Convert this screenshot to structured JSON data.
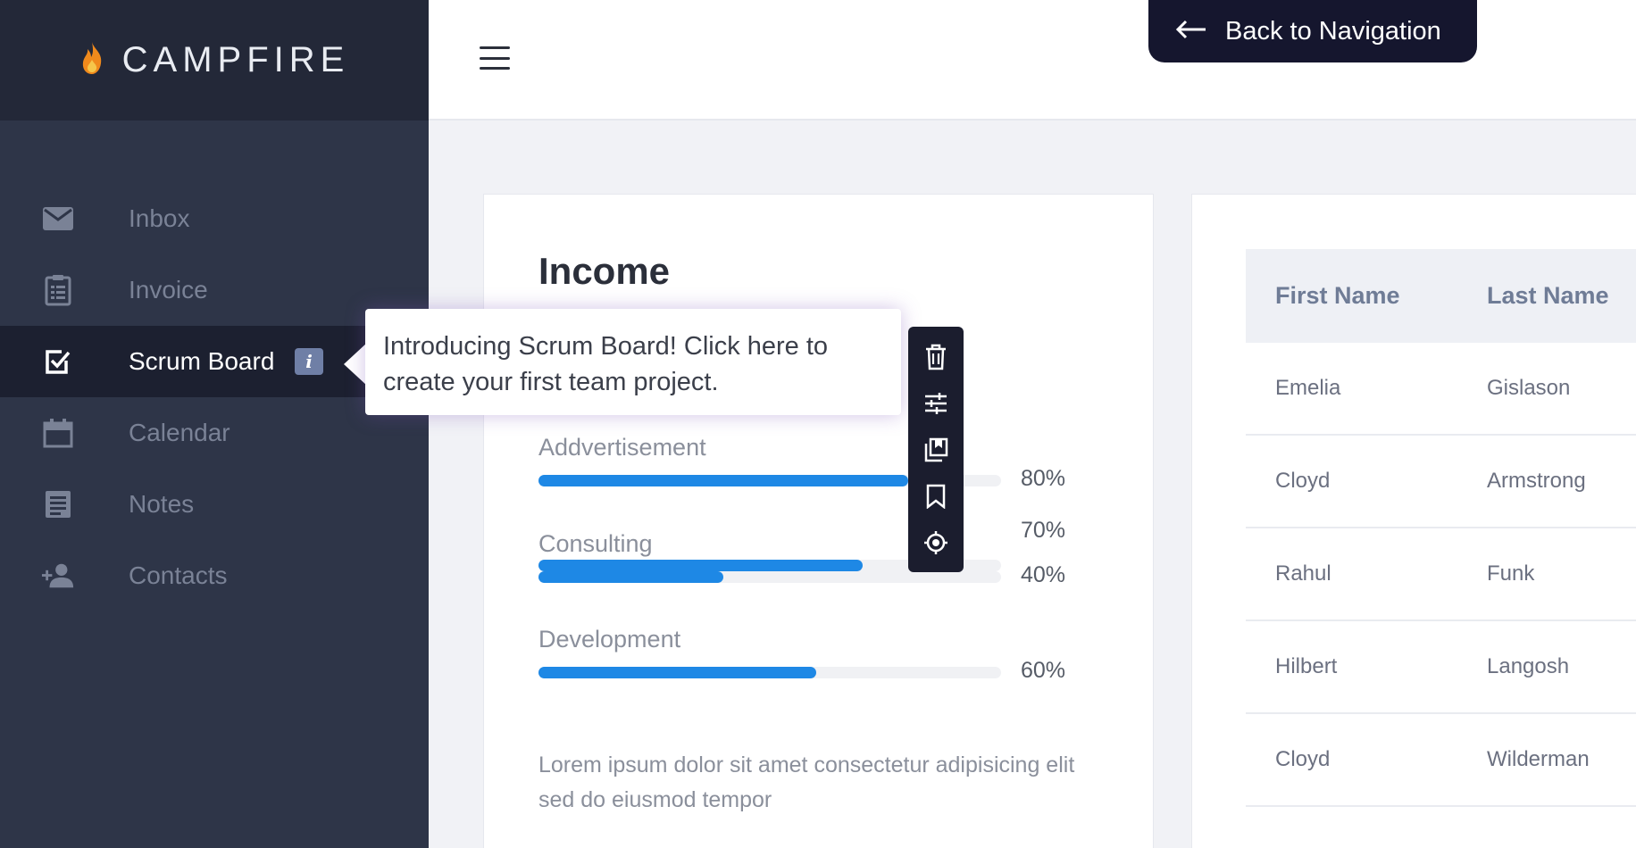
{
  "brand": {
    "name": "CAMPFIRE",
    "logo_icon": "flame-icon"
  },
  "sidebar": {
    "items": [
      {
        "label": "Inbox",
        "icon": "mail-icon",
        "active": false
      },
      {
        "label": "Invoice",
        "icon": "clipboard-icon",
        "active": false
      },
      {
        "label": "Scrum Board",
        "icon": "checkbox-icon",
        "active": true,
        "badge": "i"
      },
      {
        "label": "Calendar",
        "icon": "calendar-icon",
        "active": false
      },
      {
        "label": "Notes",
        "icon": "notes-icon",
        "active": false
      },
      {
        "label": "Contacts",
        "icon": "add-person-icon",
        "active": false
      }
    ]
  },
  "header": {
    "back_label": "Back to Navigation",
    "menu_icon": "hamburger-icon"
  },
  "income": {
    "title": "Income",
    "bars": [
      {
        "label": "",
        "percent": 70,
        "percent_label": "70%"
      },
      {
        "label": "Addvertisement",
        "percent": 80,
        "percent_label": "80%"
      },
      {
        "label": "Consulting",
        "percent": 40,
        "percent_label": "40%"
      },
      {
        "label": "Development",
        "percent": 60,
        "percent_label": "60%"
      }
    ],
    "description": "Lorem ipsum dolor sit amet consectetur adipisicing elit sed do eiusmod tempor"
  },
  "table": {
    "headers": [
      "First Name",
      "Last Name"
    ],
    "rows": [
      [
        "Emelia",
        "Gislason"
      ],
      [
        "Cloyd",
        "Armstrong"
      ],
      [
        "Rahul",
        "Funk"
      ],
      [
        "Hilbert",
        "Langosh"
      ],
      [
        "Cloyd",
        "Wilderman"
      ]
    ]
  },
  "tooltip": {
    "text": "Introducing Scrum Board! Click here to create your first team project."
  },
  "toolbar": {
    "tools": [
      "trash-icon",
      "sliders-icon",
      "copy-icon",
      "bookmark-icon",
      "target-icon"
    ]
  },
  "colors": {
    "accent": "#1e88e5",
    "sidebar": "#2e3548",
    "sidebar_header": "#232838",
    "active_item": "#1c2030",
    "back_button": "#15162e"
  }
}
